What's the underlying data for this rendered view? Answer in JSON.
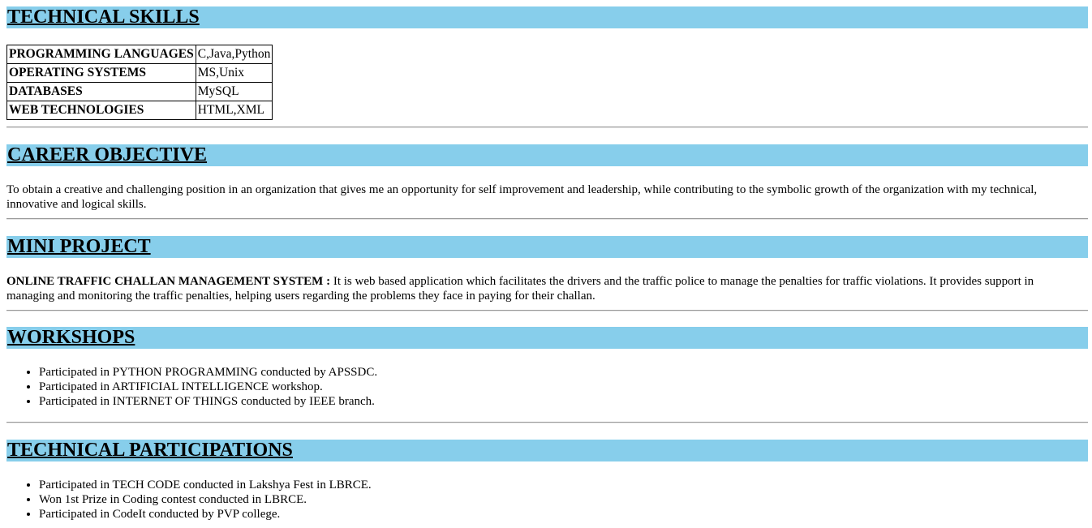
{
  "sections": {
    "skills": {
      "title": "TECHNICAL SKILLS"
    },
    "objective": {
      "title": "CAREER OBJECTIVE"
    },
    "project": {
      "title": "MINI PROJECT"
    },
    "workshops": {
      "title": "WORKSHOPS"
    },
    "participations": {
      "title": "TECHNICAL PARTICIPATIONS"
    }
  },
  "skills": [
    {
      "label": "PROGRAMMING LANGUAGES",
      "value": "C,Java,Python"
    },
    {
      "label": "OPERATING SYSTEMS",
      "value": "MS,Unix"
    },
    {
      "label": "DATABASES",
      "value": "MySQL"
    },
    {
      "label": "WEB TECHNOLOGIES",
      "value": "HTML,XML"
    }
  ],
  "objective": {
    "text": "To obtain a creative and challenging position in an organization that gives me an opportunity for self improvement and leadership, while contributing to the symbolic growth of the organization with my technical, innovative and logical skills."
  },
  "project": {
    "name": "ONLINE TRAFFIC CHALLAN MANAGEMENT SYSTEM :",
    "description": " It is web based application which facilitates the drivers and the traffic police to manage the penalties for traffic violations. It provides support in managing and monitoring the traffic penalties, helping users regarding the problems they face in paying for their challan."
  },
  "workshops": [
    "Participated in PYTHON PROGRAMMING conducted by APSSDC.",
    "Participated in ARTIFICIAL INTELLIGENCE workshop.",
    "Participated in INTERNET OF THINGS conducted by IEEE branch."
  ],
  "participations": [
    "Participated in TECH CODE conducted in Lakshya Fest in LBRCE.",
    "Won 1st Prize in Coding contest conducted in LBRCE.",
    "Participated in CodeIt conducted by PVP college."
  ],
  "colors": {
    "section_band": "#87ceeb"
  }
}
